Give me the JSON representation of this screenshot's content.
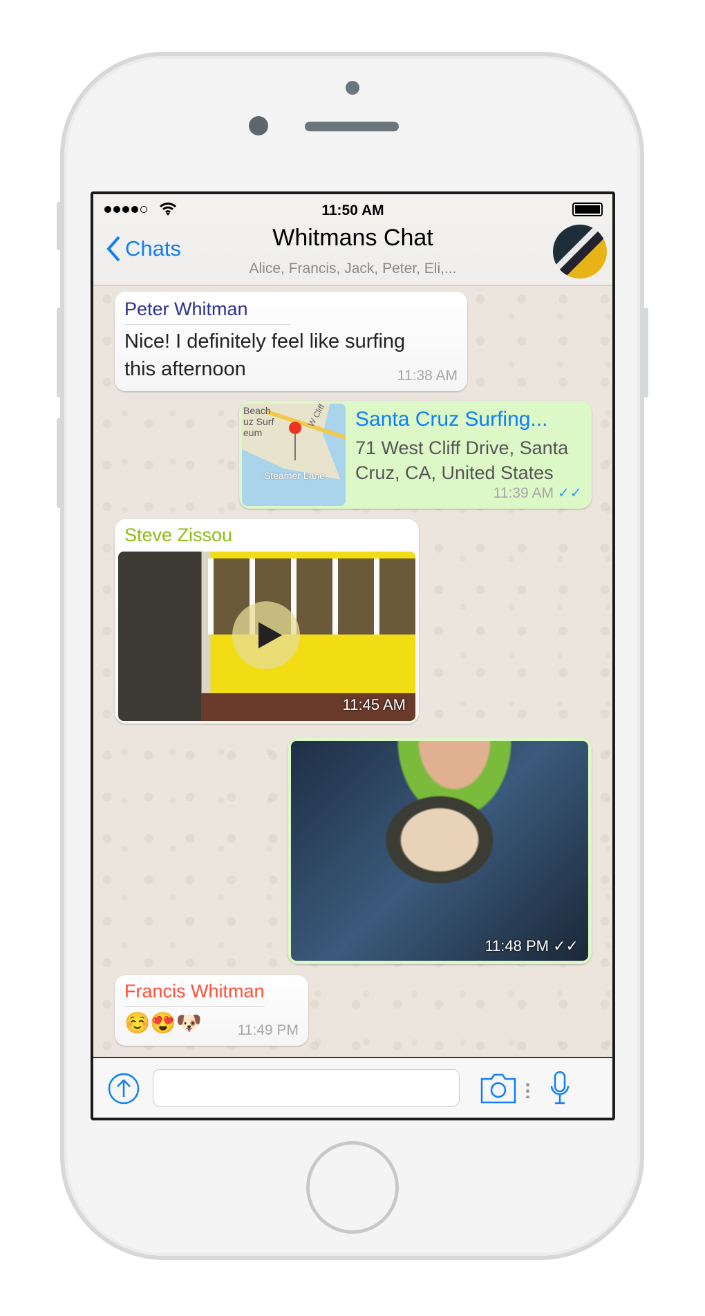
{
  "status": {
    "time": "11:50 AM",
    "signal_dots": 5,
    "signal_filled": 4
  },
  "header": {
    "back_label": "Chats",
    "title": "Whitmans Chat",
    "subtitle": "Alice, Francis, Jack, Peter, Eli,..."
  },
  "messages": [
    {
      "sender": "Peter Whitman",
      "sender_color": "#2e3192",
      "text": "Nice! I definitely feel like surfing this afternoon",
      "time": "11:38 AM",
      "direction": "incoming"
    },
    {
      "type": "location",
      "title": "Santa Cruz Surfing...",
      "address": "71 West Cliff Drive, Santa Cruz, CA, United States",
      "map_labels": [
        "Beach",
        "uz Surf",
        "eum",
        "Steamer Lane",
        "W Cliff"
      ],
      "time": "11:39 AM",
      "direction": "outgoing",
      "status": "read"
    },
    {
      "type": "video",
      "sender": "Steve Zissou",
      "sender_color": "#8dbd12",
      "time": "11:45 AM",
      "direction": "incoming"
    },
    {
      "type": "photo",
      "time": "11:48 PM",
      "direction": "outgoing",
      "status": "read"
    },
    {
      "sender": "Francis Whitman",
      "sender_color": "#ff4f3a",
      "text": "☺️😍🐶",
      "time": "11:49 PM",
      "direction": "incoming"
    }
  ],
  "input": {
    "placeholder": ""
  },
  "colors": {
    "accent": "#117ef7",
    "outgoing": "#dcf8c6",
    "background": "#ece5dd"
  }
}
